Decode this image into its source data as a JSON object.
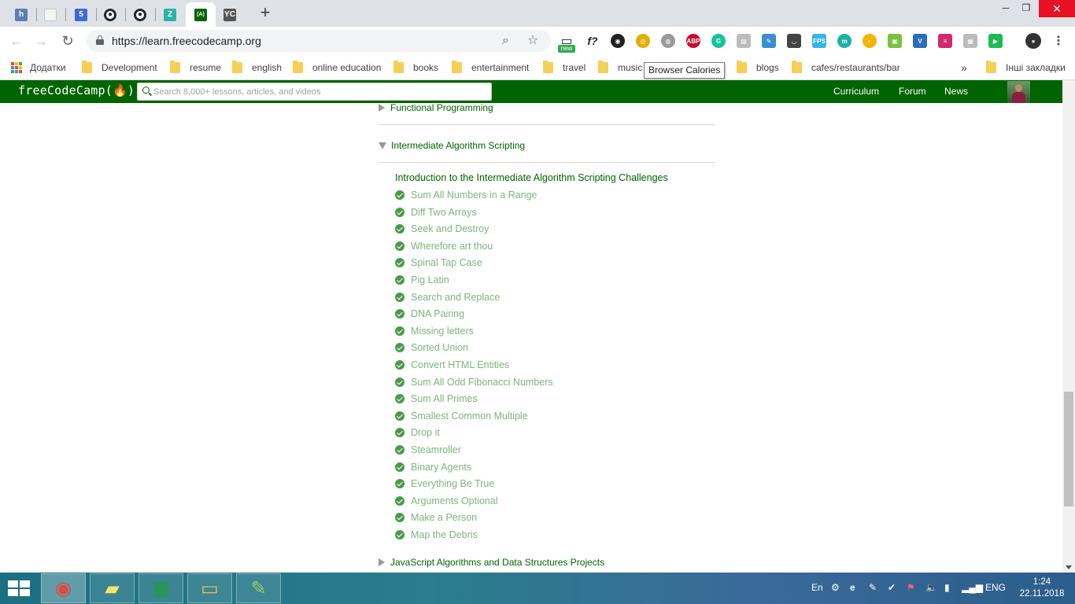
{
  "browser": {
    "tabs": [
      {
        "icon": "h-icon",
        "glyph": "h",
        "color": "#5c7fb3",
        "active": false
      },
      {
        "icon": "document-icon",
        "glyph": "",
        "color": "#c8c8c8",
        "active": false
      },
      {
        "icon": "html5-icon",
        "glyph": "5",
        "color": "#3e6bd1",
        "active": false
      },
      {
        "icon": "github-icon",
        "glyph": "●",
        "color": "#24292e",
        "active": false
      },
      {
        "icon": "github-icon",
        "glyph": "●",
        "color": "#24292e",
        "active": false
      },
      {
        "icon": "z-icon",
        "glyph": "Z",
        "color": "#2bb5a7",
        "active": false
      },
      {
        "icon": "freecodecamp-icon",
        "glyph": "(A)",
        "color": "#006400",
        "active": true
      },
      {
        "icon": "yc-icon",
        "glyph": "YC",
        "color": "#555555",
        "active": false
      }
    ],
    "new_tab_glyph": "+",
    "window_controls": {
      "minimize": "─",
      "restore": "❐",
      "close": "✕"
    },
    "url": "https://learn.freecodecamp.org",
    "ext_new_badge": "new",
    "extensions": [
      {
        "name": "screen-capture-icon",
        "glyph": "▭",
        "color": "#ffffff"
      },
      {
        "name": "formula-icon",
        "glyph": "f?",
        "color": "#ffffff"
      },
      {
        "name": "color-picker-icon",
        "glyph": "◉",
        "color": "#222222"
      },
      {
        "name": "browser-calories-icon",
        "glyph": "◎",
        "color": "#e0b000"
      },
      {
        "name": "globe-icon",
        "glyph": "◍",
        "color": "#9a9a9a"
      },
      {
        "name": "adblock-plus-icon",
        "glyph": "ABP",
        "color": "#c70d2c"
      },
      {
        "name": "grammarly-icon",
        "glyph": "G",
        "color": "#15c39a"
      },
      {
        "name": "image-icon",
        "glyph": "▨",
        "color": "#bbbbbb"
      },
      {
        "name": "pen-icon",
        "glyph": "✎",
        "color": "#3a8fd1"
      },
      {
        "name": "pocket-icon",
        "glyph": "◡",
        "color": "#444444"
      },
      {
        "name": "fps-icon",
        "glyph": "FPS",
        "color": "#33b5e5"
      },
      {
        "name": "mercury-icon",
        "glyph": "m",
        "color": "#1bb3a3"
      },
      {
        "name": "night-mode-icon",
        "glyph": "◐",
        "color": "#f5b400"
      },
      {
        "name": "evernote-icon",
        "glyph": "▣",
        "color": "#7ac142"
      },
      {
        "name": "vuejs-icon",
        "glyph": "V",
        "color": "#2a6ebb"
      },
      {
        "name": "elementor-icon",
        "glyph": "≡",
        "color": "#d12a6e"
      },
      {
        "name": "grid-icon",
        "glyph": "▦",
        "color": "#bbbbbb"
      },
      {
        "name": "play-icon",
        "glyph": "▶",
        "color": "#1db954"
      },
      {
        "name": "profile-avatar-icon",
        "glyph": "●",
        "color": "#333333"
      },
      {
        "name": "menu-kebab-icon",
        "glyph": "⋮",
        "color": "#5f6368"
      }
    ],
    "bookmarks": [
      {
        "label": "Додатки",
        "kind": "apps"
      },
      {
        "label": "Development",
        "kind": "folder"
      },
      {
        "label": "resume",
        "kind": "folder"
      },
      {
        "label": "english",
        "kind": "folder"
      },
      {
        "label": "online education",
        "kind": "folder"
      },
      {
        "label": "books",
        "kind": "folder"
      },
      {
        "label": "entertainment",
        "kind": "folder"
      },
      {
        "label": "travel",
        "kind": "folder"
      },
      {
        "label": "music",
        "kind": "folder"
      },
      {
        "label": "blogs",
        "kind": "folder"
      },
      {
        "label": "cafes/restaurants/bar",
        "kind": "folder"
      }
    ],
    "bookmarks_overflow": "»",
    "other_bookmarks": "Інші закладки",
    "tooltip": "Browser Calories"
  },
  "fcc": {
    "logo": "freeCodeCamp(🔥)",
    "search_placeholder": "Search 8,000+ lessons, articles, and videos",
    "nav": [
      "Curriculum",
      "Forum",
      "News"
    ]
  },
  "curriculum": {
    "prev_block": "Functional Programming",
    "current_block": "Intermediate Algorithm Scripting",
    "intro": "Introduction to the Intermediate Algorithm Scripting Challenges",
    "challenges": [
      "Sum All Numbers in a Range",
      "Diff Two Arrays",
      "Seek and Destroy",
      "Wherefore art thou",
      "Spinal Tap Case",
      "Pig Latin",
      "Search and Replace",
      "DNA Pairing",
      "Missing letters",
      "Sorted Union",
      "Convert HTML Entities",
      "Sum All Odd Fibonacci Numbers",
      "Sum All Primes",
      "Smallest Common Multiple",
      "Drop it",
      "Steamroller",
      "Binary Agents",
      "Everything Be True",
      "Arguments Optional",
      "Make a Person",
      "Map the Debris"
    ],
    "next_block": "JavaScript Algorithms and Data Structures Projects"
  },
  "taskbar": {
    "apps": [
      {
        "name": "chrome-icon",
        "active": true
      },
      {
        "name": "sticky-notes-icon",
        "active": false
      },
      {
        "name": "calculator-icon",
        "active": false
      },
      {
        "name": "file-explorer-icon",
        "active": false
      },
      {
        "name": "notepad-icon",
        "active": false
      }
    ],
    "tray": {
      "lang_short": "En",
      "lang": "ENG",
      "time": "1:24",
      "date": "22.11.2018"
    }
  }
}
